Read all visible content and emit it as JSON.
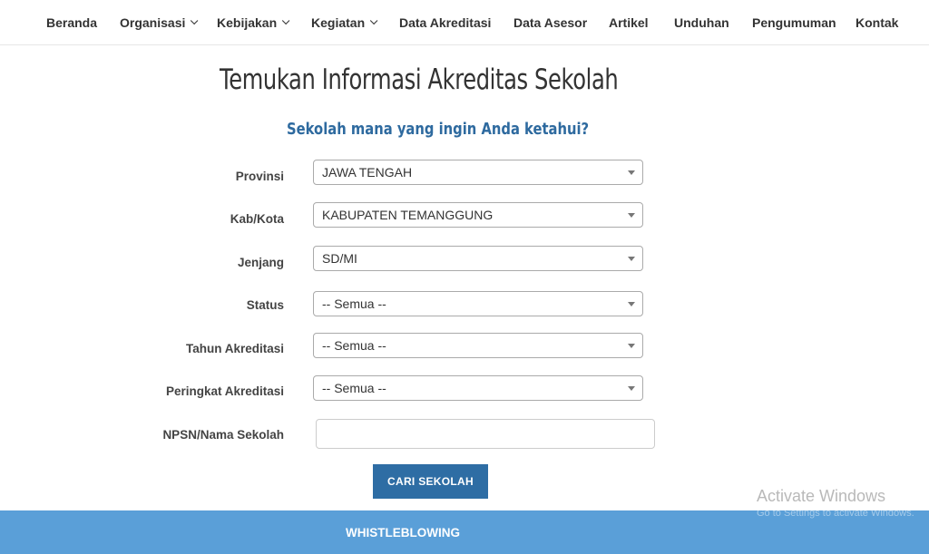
{
  "nav": {
    "items": [
      {
        "label": "Beranda",
        "dropdown": false
      },
      {
        "label": "Organisasi",
        "dropdown": true
      },
      {
        "label": "Kebijakan",
        "dropdown": true
      },
      {
        "label": "Kegiatan",
        "dropdown": true
      },
      {
        "label": "Data Akreditasi",
        "dropdown": false
      },
      {
        "label": "Data Asesor",
        "dropdown": false
      },
      {
        "label": "Artikel",
        "dropdown": false
      },
      {
        "label": "Unduhan",
        "dropdown": false
      },
      {
        "label": "Pengumuman",
        "dropdown": false
      },
      {
        "label": "Kontak",
        "dropdown": false
      }
    ]
  },
  "main": {
    "title": "Temukan Informasi Akreditas Sekolah",
    "subtitle": "Sekolah mana yang ingin Anda ketahui?"
  },
  "form": {
    "fields": [
      {
        "label": "Provinsi",
        "value": "JAWA TENGAH"
      },
      {
        "label": "Kab/Kota",
        "value": "KABUPATEN TEMANGGUNG"
      },
      {
        "label": "Jenjang",
        "value": "SD/MI"
      },
      {
        "label": "Status",
        "value": "-- Semua --"
      },
      {
        "label": "Tahun Akreditasi",
        "value": "-- Semua --"
      },
      {
        "label": "Peringkat Akreditasi",
        "value": "-- Semua --"
      }
    ],
    "npsn_label": "NPSN/Nama Sekolah",
    "npsn_value": "",
    "search_button": "CARI SEKOLAH"
  },
  "footer": {
    "whistleblowing": "WHISTLEBLOWING"
  },
  "watermark": {
    "title": "Activate Windows",
    "subtitle": "Go to Settings to activate Windows."
  },
  "colors": {
    "accent": "#2e6da4",
    "footer_bar": "#5a9fd8",
    "subtitle": "#2e6a9f"
  }
}
